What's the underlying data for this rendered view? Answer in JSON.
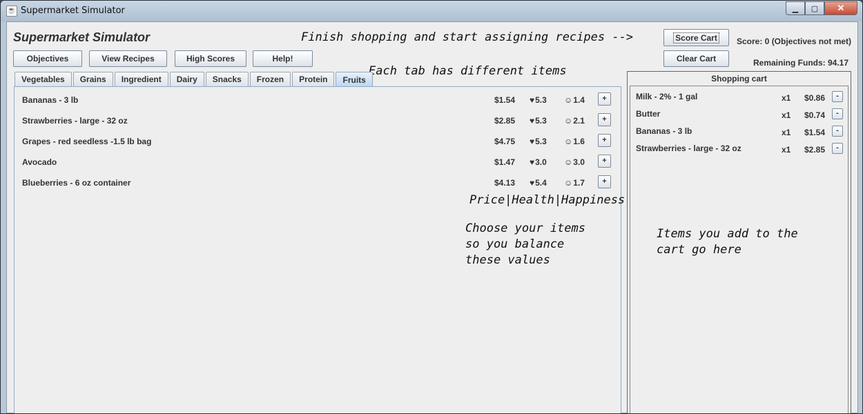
{
  "window": {
    "title": "Supermarket Simulator",
    "minimize": "▁",
    "maximize": "▢",
    "close": "✕"
  },
  "app_title": "Supermarket Simulator",
  "annotations": {
    "finish": "Finish shopping and start assigning recipes -->",
    "tabs": "Each tab has different items",
    "columns": "Price|Health|Happiness",
    "balance": "Choose your items\nso you balance\nthese values",
    "cart": "Items you add to the\ncart go here"
  },
  "buttons": {
    "objectives": "Objectives",
    "view_recipes": "View Recipes",
    "high_scores": "High Scores",
    "help": "Help!",
    "score_cart": "Score Cart",
    "clear_cart": "Clear Cart"
  },
  "status": {
    "score": "Score: 0  (Objectives not met)",
    "remaining_funds": "Remaining Funds: 94.17"
  },
  "tabs": [
    "Vegetables",
    "Grains",
    "Ingredient",
    "Dairy",
    "Snacks",
    "Frozen",
    "Protein",
    "Fruits"
  ],
  "active_tab": "Fruits",
  "icons": {
    "health": "heart-icon",
    "happiness": "smiley-icon"
  },
  "items": [
    {
      "name": "Bananas - 3 lb",
      "price": "$1.54",
      "health": "5.3",
      "happiness": "1.4",
      "add": "+"
    },
    {
      "name": "Strawberries - large - 32 oz",
      "price": "$2.85",
      "health": "5.3",
      "happiness": "2.1",
      "add": "+"
    },
    {
      "name": "Grapes - red seedless -1.5 lb bag",
      "price": "$4.75",
      "health": "5.3",
      "happiness": "1.6",
      "add": "+"
    },
    {
      "name": "Avocado",
      "price": "$1.47",
      "health": "3.0",
      "happiness": "3.0",
      "add": "+"
    },
    {
      "name": "Blueberries -  6 oz container",
      "price": "$4.13",
      "health": "5.4",
      "happiness": "1.7",
      "add": "+"
    }
  ],
  "cart": {
    "title": "Shopping cart",
    "items": [
      {
        "name": "Milk - 2% - 1 gal",
        "qty": "x1",
        "price": "$0.86",
        "remove": "-"
      },
      {
        "name": "Butter",
        "qty": "x1",
        "price": "$0.74",
        "remove": "-"
      },
      {
        "name": "Bananas - 3 lb",
        "qty": "x1",
        "price": "$1.54",
        "remove": "-"
      },
      {
        "name": "Strawberries - large - 32 oz",
        "qty": "x1",
        "price": "$2.85",
        "remove": "-"
      }
    ]
  }
}
